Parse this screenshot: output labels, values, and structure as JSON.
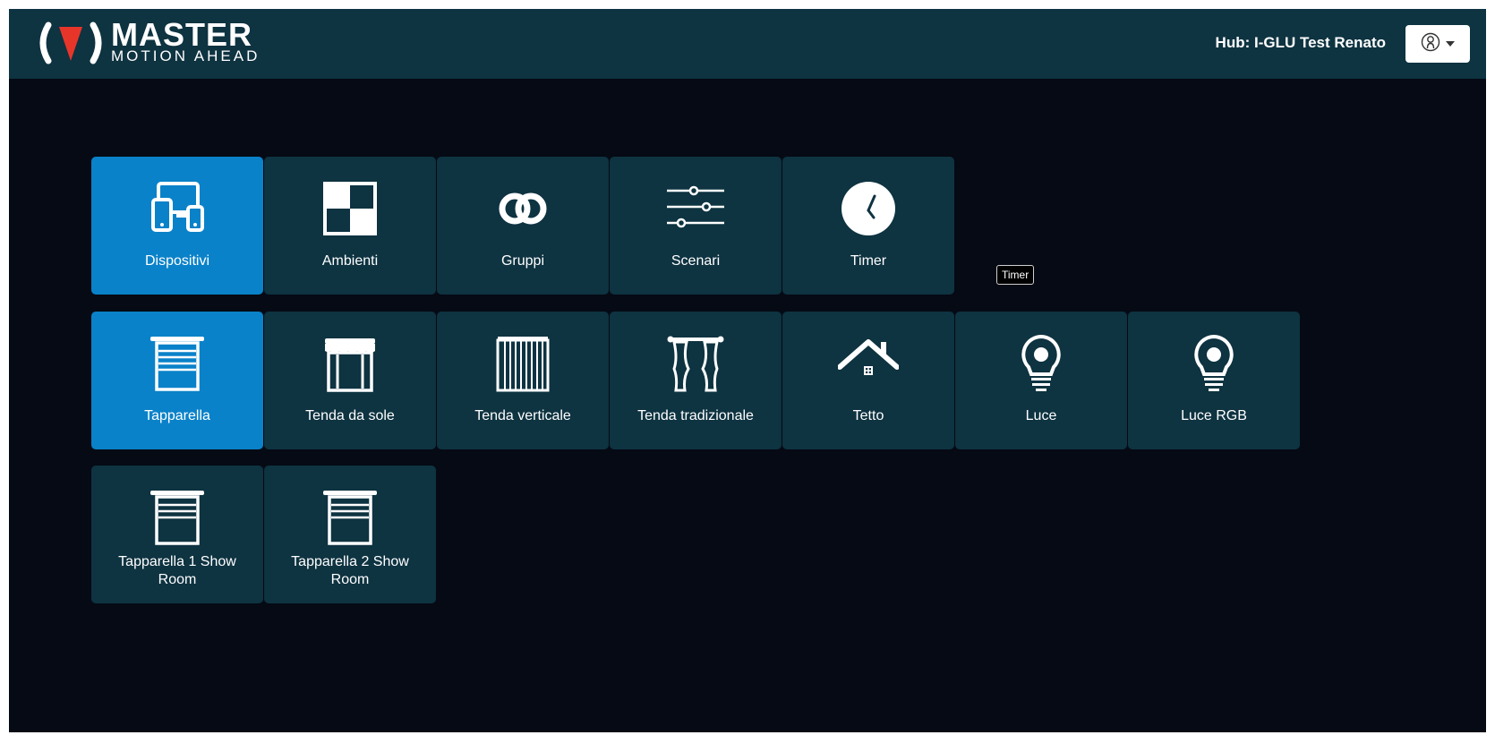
{
  "header": {
    "logo_title": "MASTER",
    "logo_subtitle": "MOTION AHEAD",
    "hub_label": "Hub: I-GLU Test Renato",
    "brand_color": "#e8352a"
  },
  "colors": {
    "tile": "#0e3341",
    "tile_active": "#0a82c9",
    "background": "#050a14",
    "header": "#0e3341"
  },
  "categories": [
    {
      "label": "Dispositivi",
      "icon": "devices-icon",
      "active": true
    },
    {
      "label": "Ambienti",
      "icon": "rooms-icon",
      "active": false
    },
    {
      "label": "Gruppi",
      "icon": "groups-icon",
      "active": false
    },
    {
      "label": "Scenari",
      "icon": "scenarios-icon",
      "active": false
    },
    {
      "label": "Timer",
      "icon": "timer-icon",
      "active": false
    }
  ],
  "tooltip": "Timer",
  "device_types": [
    {
      "label": "Tapparella",
      "icon": "roller-shutter-icon",
      "active": true
    },
    {
      "label": "Tenda da sole",
      "icon": "awning-icon",
      "active": false
    },
    {
      "label": "Tenda verticale",
      "icon": "vertical-blind-icon",
      "active": false
    },
    {
      "label": "Tenda tradizionale",
      "icon": "curtain-icon",
      "active": false
    },
    {
      "label": "Tetto",
      "icon": "roof-icon",
      "active": false
    },
    {
      "label": "Luce",
      "icon": "light-bulb-icon",
      "active": false
    },
    {
      "label": "Luce RGB",
      "icon": "rgb-light-bulb-icon",
      "active": false
    }
  ],
  "devices": [
    {
      "label_line1": "Tapparella 1 Show",
      "label_line2": "Room",
      "icon": "roller-shutter-icon"
    },
    {
      "label_line1": "Tapparella 2 Show",
      "label_line2": "Room",
      "icon": "roller-shutter-icon"
    }
  ]
}
